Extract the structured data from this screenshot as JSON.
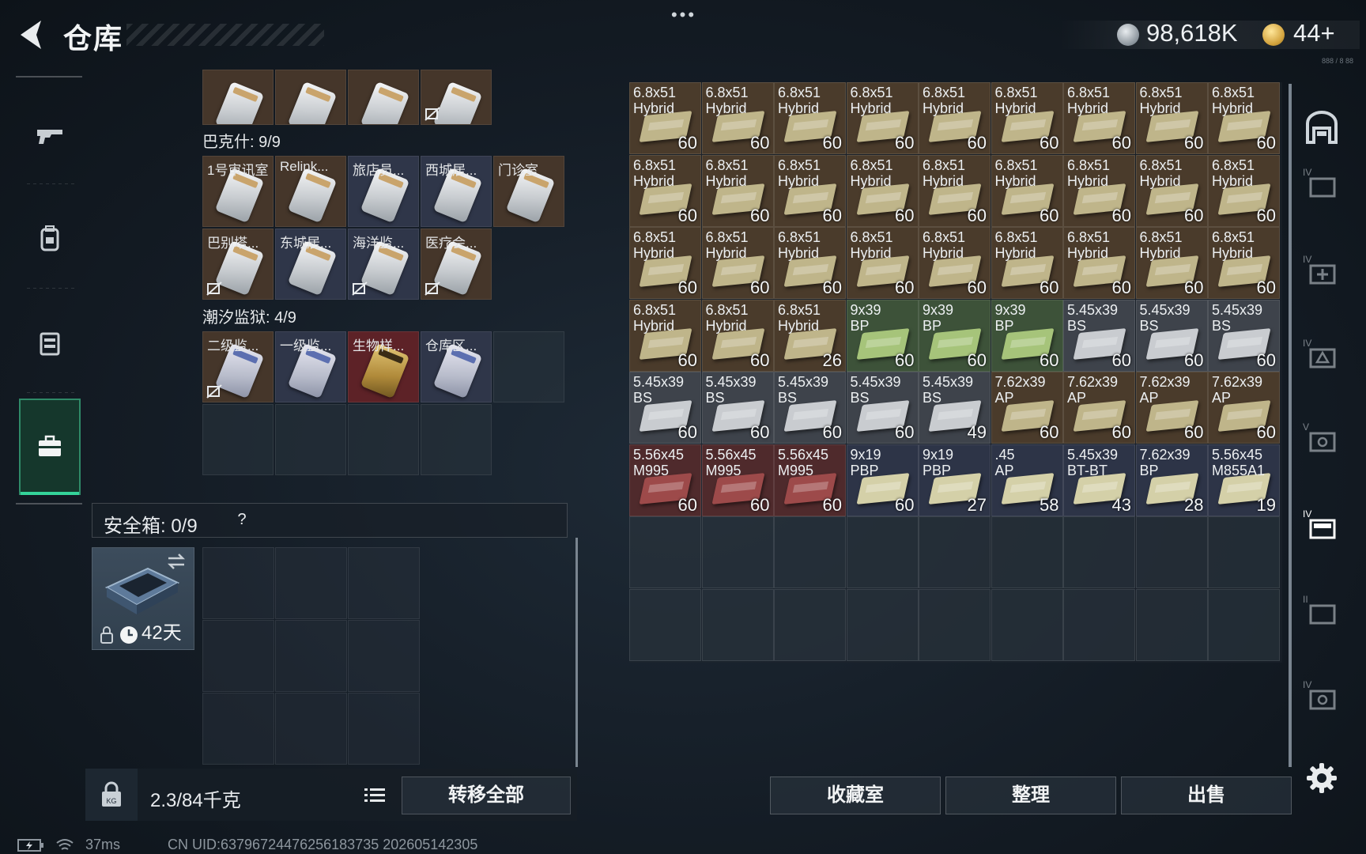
{
  "header": {
    "title": "仓库",
    "dots": "•••",
    "currency": {
      "silver": "98,618K",
      "gold": "44+"
    },
    "sub_text": "888 / 8 88"
  },
  "keys": {
    "top_row": [
      {
        "label": "",
        "card": "white",
        "no_insure": false
      },
      {
        "label": "",
        "card": "white",
        "no_insure": false
      },
      {
        "label": "",
        "card": "white",
        "no_insure": false
      },
      {
        "label": "",
        "card": "white",
        "no_insure": true
      }
    ],
    "section1_title": "巴克什: 9/9",
    "section1_row1": [
      {
        "label": "1号审讯室",
        "no_insure": false
      },
      {
        "label": "Relink...",
        "no_insure": false
      },
      {
        "label": "旅店员...",
        "no_insure": false
      },
      {
        "label": "西城居...",
        "no_insure": false
      },
      {
        "label": "门诊室",
        "no_insure": false
      }
    ],
    "section1_row2": [
      {
        "label": "巴别塔...",
        "no_insure": true
      },
      {
        "label": "东城居...",
        "no_insure": false
      },
      {
        "label": "海洋监...",
        "no_insure": true
      },
      {
        "label": "医疗会...",
        "no_insure": true
      }
    ],
    "section2_title": "潮汐监狱: 4/9",
    "section2_row1": [
      {
        "label": "二级监...",
        "no_insure": true
      },
      {
        "label": "一级监...",
        "no_insure": false
      },
      {
        "label": "生物样...",
        "no_insure": false
      },
      {
        "label": "仓库区...",
        "no_insure": false
      }
    ]
  },
  "safe_box": {
    "title": "安全箱:  0/9",
    "help": "?",
    "time_left": "42天"
  },
  "bottom_left": {
    "weight": "2.3/84千克",
    "transfer_all": "转移全部"
  },
  "stash": {
    "rows": [
      [
        {
          "name": "6.8x51\nHybrid",
          "qty": "60",
          "color": "brown"
        },
        {
          "name": "6.8x51\nHybrid",
          "qty": "60",
          "color": "brown"
        },
        {
          "name": "6.8x51\nHybrid",
          "qty": "60",
          "color": "brown"
        },
        {
          "name": "6.8x51\nHybrid",
          "qty": "60",
          "color": "brown"
        },
        {
          "name": "6.8x51\nHybrid",
          "qty": "60",
          "color": "brown"
        },
        {
          "name": "6.8x51\nHybrid",
          "qty": "60",
          "color": "brown"
        },
        {
          "name": "6.8x51\nHybrid",
          "qty": "60",
          "color": "brown"
        },
        {
          "name": "6.8x51\nHybrid",
          "qty": "60",
          "color": "brown"
        },
        {
          "name": "6.8x51\nHybrid",
          "qty": "60",
          "color": "brown"
        }
      ],
      [
        {
          "name": "6.8x51\nHybrid",
          "qty": "60",
          "color": "brown"
        },
        {
          "name": "6.8x51\nHybrid",
          "qty": "60",
          "color": "brown"
        },
        {
          "name": "6.8x51\nHybrid",
          "qty": "60",
          "color": "brown"
        },
        {
          "name": "6.8x51\nHybrid",
          "qty": "60",
          "color": "brown"
        },
        {
          "name": "6.8x51\nHybrid",
          "qty": "60",
          "color": "brown"
        },
        {
          "name": "6.8x51\nHybrid",
          "qty": "60",
          "color": "brown"
        },
        {
          "name": "6.8x51\nHybrid",
          "qty": "60",
          "color": "brown"
        },
        {
          "name": "6.8x51\nHybrid",
          "qty": "60",
          "color": "brown"
        },
        {
          "name": "6.8x51\nHybrid",
          "qty": "60",
          "color": "brown"
        }
      ],
      [
        {
          "name": "6.8x51\nHybrid",
          "qty": "60",
          "color": "brown"
        },
        {
          "name": "6.8x51\nHybrid",
          "qty": "60",
          "color": "brown"
        },
        {
          "name": "6.8x51\nHybrid",
          "qty": "60",
          "color": "brown"
        },
        {
          "name": "6.8x51\nHybrid",
          "qty": "60",
          "color": "brown"
        },
        {
          "name": "6.8x51\nHybrid",
          "qty": "60",
          "color": "brown"
        },
        {
          "name": "6.8x51\nHybrid",
          "qty": "60",
          "color": "brown"
        },
        {
          "name": "6.8x51\nHybrid",
          "qty": "60",
          "color": "brown"
        },
        {
          "name": "6.8x51\nHybrid",
          "qty": "60",
          "color": "brown"
        },
        {
          "name": "6.8x51\nHybrid",
          "qty": "60",
          "color": "brown"
        }
      ],
      [
        {
          "name": "6.8x51\nHybrid",
          "qty": "60",
          "color": "brown"
        },
        {
          "name": "6.8x51\nHybrid",
          "qty": "60",
          "color": "brown"
        },
        {
          "name": "6.8x51\nHybrid",
          "qty": "26",
          "color": "brown"
        },
        {
          "name": "9x39\nBP",
          "qty": "60",
          "color": "green"
        },
        {
          "name": "9x39\nBP",
          "qty": "60",
          "color": "green"
        },
        {
          "name": "9x39\nBP",
          "qty": "60",
          "color": "green"
        },
        {
          "name": "5.45x39\nBS",
          "qty": "60",
          "color": "gray"
        },
        {
          "name": "5.45x39\nBS",
          "qty": "60",
          "color": "gray"
        },
        {
          "name": "5.45x39\nBS",
          "qty": "60",
          "color": "gray"
        }
      ],
      [
        {
          "name": "5.45x39\nBS",
          "qty": "60",
          "color": "gray"
        },
        {
          "name": "5.45x39\nBS",
          "qty": "60",
          "color": "gray"
        },
        {
          "name": "5.45x39\nBS",
          "qty": "60",
          "color": "gray"
        },
        {
          "name": "5.45x39\nBS",
          "qty": "60",
          "color": "gray"
        },
        {
          "name": "5.45x39\nBS",
          "qty": "49",
          "color": "gray"
        },
        {
          "name": "7.62x39\nAP",
          "qty": "60",
          "color": "brown"
        },
        {
          "name": "7.62x39\nAP",
          "qty": "60",
          "color": "brown"
        },
        {
          "name": "7.62x39\nAP",
          "qty": "60",
          "color": "brown"
        },
        {
          "name": "7.62x39\nAP",
          "qty": "60",
          "color": "brown"
        }
      ],
      [
        {
          "name": "5.56x45\nM995",
          "qty": "60",
          "color": "red"
        },
        {
          "name": "5.56x45\nM995",
          "qty": "60",
          "color": "red"
        },
        {
          "name": "5.56x45\nM995",
          "qty": "60",
          "color": "red"
        },
        {
          "name": "9x19\nPBP",
          "qty": "60",
          "color": "blue"
        },
        {
          "name": "9x19\nPBP",
          "qty": "27",
          "color": "blue"
        },
        {
          "name": ".45\nAP",
          "qty": "58",
          "color": "blue"
        },
        {
          "name": "5.45x39\nBT-BT",
          "qty": "43",
          "color": "blue"
        },
        {
          "name": "7.62x39\nBP",
          "qty": "28",
          "color": "blue"
        },
        {
          "name": "5.56x45\nM855A1",
          "qty": "19",
          "color": "blue"
        }
      ]
    ],
    "empty_rows": 2
  },
  "bottom_right": {
    "collection": "收藏室",
    "sort": "整理",
    "sell": "出售"
  },
  "status": {
    "ping": "37ms",
    "uid": "CN UID:6379672447625618373​5 202605142305"
  }
}
